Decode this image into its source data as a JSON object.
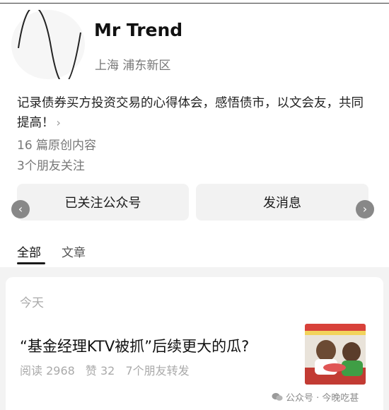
{
  "profile": {
    "name": "Mr Trend",
    "location": "上海 浦东新区",
    "bio": "记录债券买方投资交易的心得体会，感悟债市，以文会友，共同提高！",
    "bio_more_icon": "chevron-right-icon",
    "original_count": "16 篇原创内容",
    "friends_following": "3个朋友关注"
  },
  "actions": {
    "follow_label": "已关注公众号",
    "message_label": "发消息"
  },
  "tabs": [
    {
      "label": "全部",
      "active": true
    },
    {
      "label": "文章",
      "active": false
    }
  ],
  "feed": {
    "date_label": "今天",
    "article": {
      "title": "“基金经理KTV被抓”后续更大的瓜?",
      "reads": "阅读 2968",
      "likes": "赞 32",
      "friend_shares": "7个朋友转发"
    }
  },
  "watermark": {
    "text": "公众号 · 今晚吃甚",
    "icon": "wechat-icon"
  },
  "colors": {
    "background": "#ffffff",
    "button_bg": "#f2f2f2",
    "muted_text": "#777777",
    "feed_bg": "#f3f3f3"
  }
}
